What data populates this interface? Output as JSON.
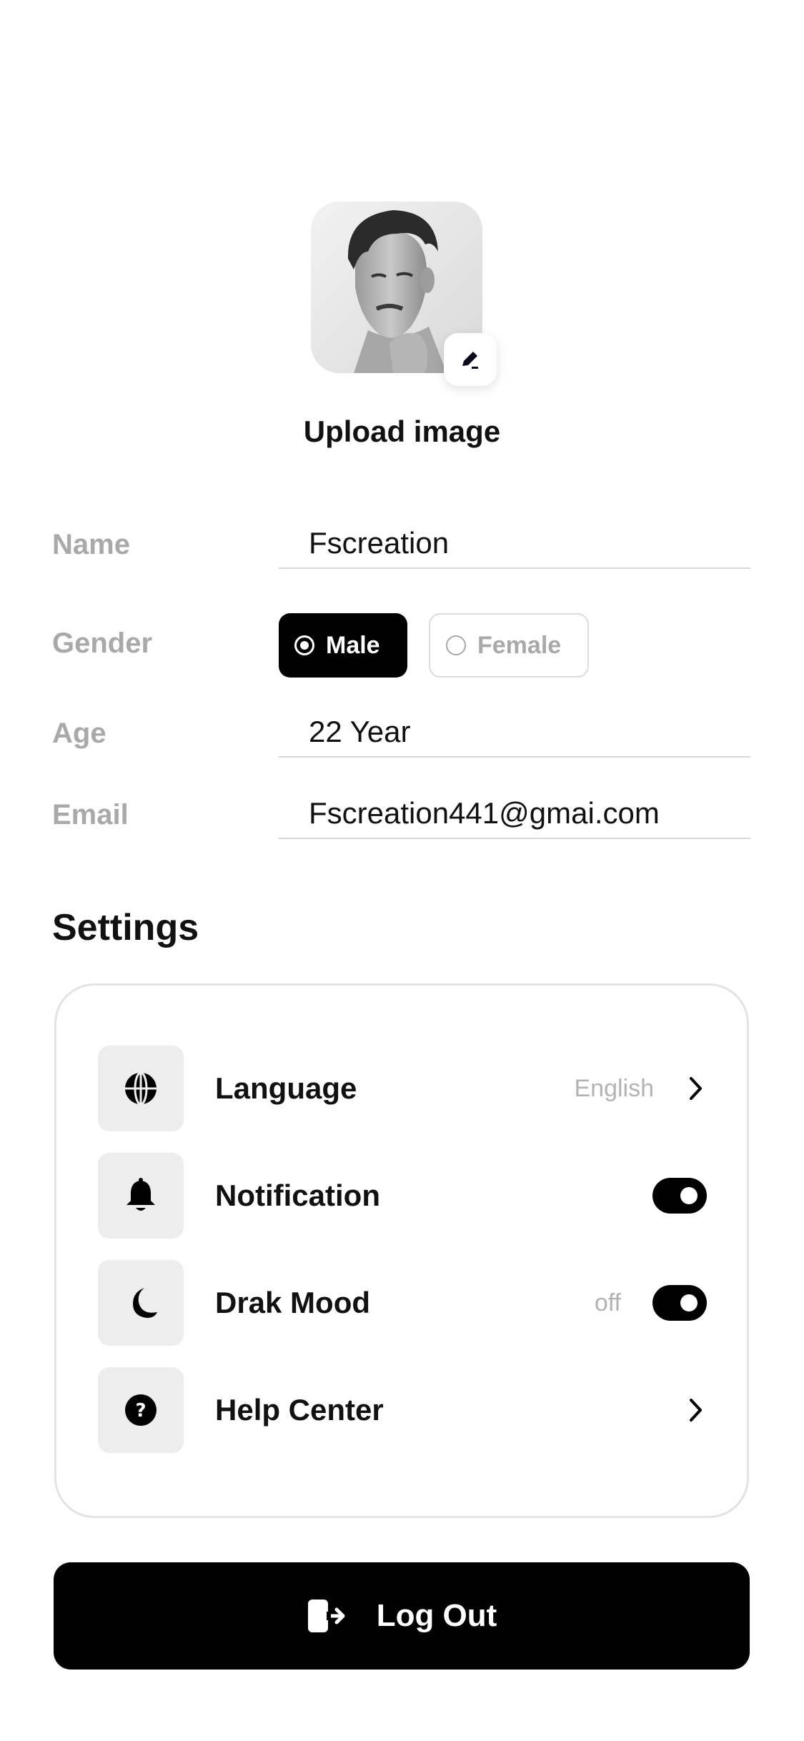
{
  "profile": {
    "upload_label": "Upload image",
    "avatar_alt": "profile-photo"
  },
  "form": {
    "name_label": "Name",
    "name_value": "Fscreation",
    "gender_label": "Gender",
    "gender_options": [
      "Male",
      "Female"
    ],
    "gender_selected": "Male",
    "age_label": "Age",
    "age_value": "22 Year",
    "email_label": "Email",
    "email_value": "Fscreation441@gmai.com"
  },
  "settings": {
    "title": "Settings",
    "items": [
      {
        "label": "Language",
        "value": "English",
        "icon": "globe-icon",
        "control": "chevron"
      },
      {
        "label": "Notification",
        "value": "",
        "icon": "bell-icon",
        "control": "toggle"
      },
      {
        "label": "Drak Mood",
        "value": "off",
        "icon": "moon-icon",
        "control": "toggle"
      },
      {
        "label": "Help Center",
        "value": "",
        "icon": "help-icon",
        "control": "chevron"
      }
    ]
  },
  "logout": {
    "label": "Log Out",
    "icon": "logout-icon"
  },
  "colors": {
    "primary": "#000000",
    "muted_text": "#a9a9a9",
    "icon_bg": "#ededed"
  }
}
